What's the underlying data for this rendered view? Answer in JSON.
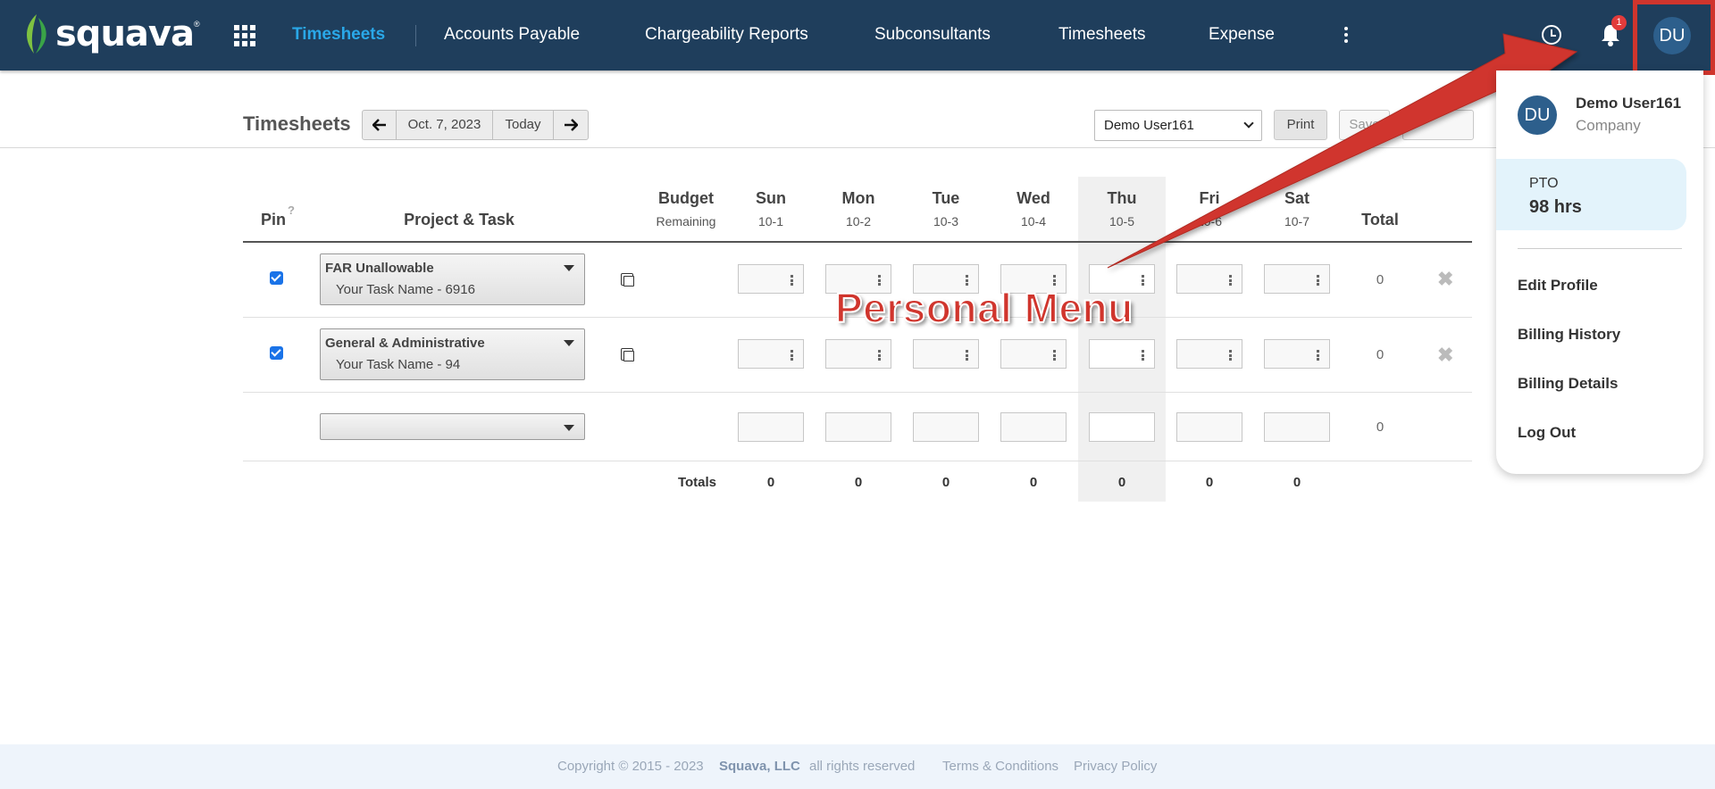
{
  "brand": {
    "name": "squava",
    "reg": "®"
  },
  "nav": {
    "items": [
      "Timesheets",
      "Accounts Payable",
      "Chargeability Reports",
      "Subconsultants",
      "Timesheets",
      "Expense"
    ],
    "active_index": 0
  },
  "header": {
    "notification_count": "1",
    "avatar_initials": "DU"
  },
  "toolbar": {
    "title": "Timesheets",
    "date": "Oct. 7, 2023",
    "today": "Today",
    "user_select": "Demo User161",
    "print": "Print",
    "save": "Save"
  },
  "grid": {
    "pin_label": "Pin",
    "pin_help": "?",
    "project_label": "Project & Task",
    "budget_label": "Budget",
    "budget_sub": "Remaining",
    "days": [
      {
        "name": "Sun",
        "date": "10-1"
      },
      {
        "name": "Mon",
        "date": "10-2"
      },
      {
        "name": "Tue",
        "date": "10-3"
      },
      {
        "name": "Wed",
        "date": "10-4"
      },
      {
        "name": "Thu",
        "date": "10-5"
      },
      {
        "name": "Fri",
        "date": "10-6"
      },
      {
        "name": "Sat",
        "date": "10-7"
      }
    ],
    "total_label": "Total",
    "rows": [
      {
        "project": "FAR Unallowable",
        "task": "Your Task Name - 6916",
        "pinned": true,
        "total": "0"
      },
      {
        "project": "General & Administrative",
        "task": "Your Task Name - 94",
        "pinned": true,
        "total": "0"
      },
      {
        "project": "",
        "task": "",
        "pinned": false,
        "total": "0"
      }
    ],
    "totals_label": "Totals",
    "totals": [
      "0",
      "0",
      "0",
      "0",
      "0",
      "0",
      "0"
    ]
  },
  "annotation": {
    "callout": "Personal Menu",
    "color": "#d0352d"
  },
  "personal_menu": {
    "initials": "DU",
    "name": "Demo User161",
    "company": "Company",
    "pto_label": "PTO",
    "pto_value": "98 hrs",
    "items": [
      "Edit Profile",
      "Billing History",
      "Billing Details",
      "Log Out"
    ]
  },
  "footer": {
    "copyright": "Copyright © 2015 - 2023",
    "company": "Squava, LLC",
    "rights": "all rights reserved",
    "terms": "Terms & Conditions",
    "privacy": "Privacy Policy"
  },
  "colors": {
    "topbar": "#1f3e5c",
    "accent": "#2aa8e8",
    "annotation": "#d0352d"
  }
}
